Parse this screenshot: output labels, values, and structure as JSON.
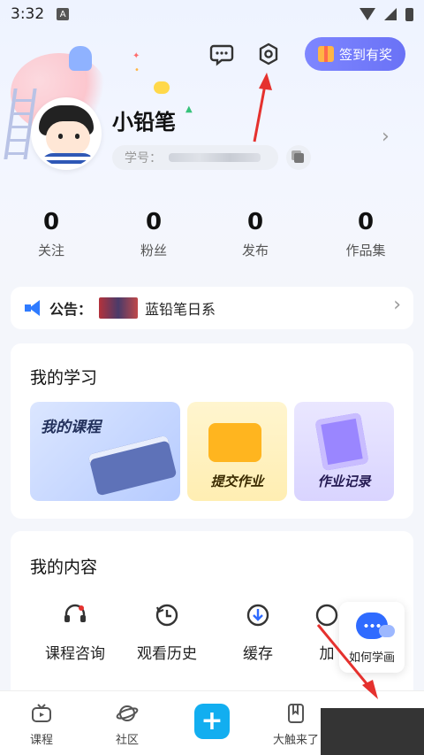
{
  "status_bar": {
    "time": "3:32",
    "notification_letter": "A"
  },
  "header": {
    "checkin_label": "签到有奖"
  },
  "profile": {
    "name": "小铅笔",
    "id_label": "学号："
  },
  "stats": [
    {
      "value": "0",
      "label": "关注"
    },
    {
      "value": "0",
      "label": "粉丝"
    },
    {
      "value": "0",
      "label": "发布"
    },
    {
      "value": "0",
      "label": "作品集"
    }
  ],
  "announcement": {
    "label": "公告：",
    "text": "蓝铅笔日系"
  },
  "learning": {
    "title": "我的学习",
    "tiles": [
      {
        "label": "我的课程"
      },
      {
        "label": "提交作业"
      },
      {
        "label": "作业记录"
      }
    ]
  },
  "content": {
    "title": "我的内容",
    "items": [
      {
        "label": "课程咨询",
        "icon": "headset-icon"
      },
      {
        "label": "观看历史",
        "icon": "history-icon"
      },
      {
        "label": "缓存",
        "icon": "download-icon"
      },
      {
        "label": "加",
        "icon": "partial-icon"
      }
    ]
  },
  "help_float": {
    "label": "如何学画"
  },
  "bottom_nav": [
    {
      "label": "课程",
      "icon": "tv-icon"
    },
    {
      "label": "社区",
      "icon": "planet-icon"
    },
    {
      "label": "+",
      "icon": "plus-icon"
    },
    {
      "label": "大触来了",
      "icon": "book-icon"
    }
  ],
  "colors": {
    "accent": "#6a72f6",
    "plus": "#12aef0",
    "arrow": "#e5312e",
    "blue": "#2f6bff"
  }
}
